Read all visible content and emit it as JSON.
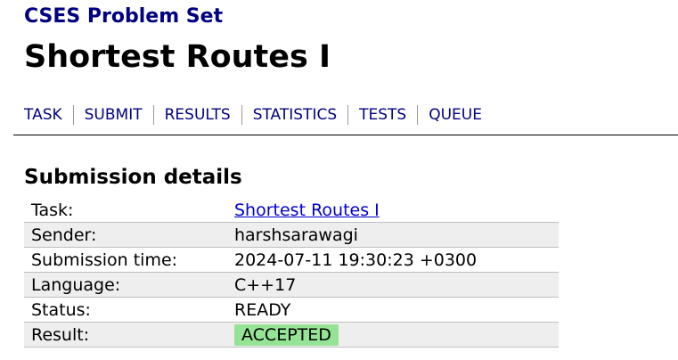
{
  "site": {
    "title": "CSES Problem Set"
  },
  "page": {
    "title": "Shortest Routes I"
  },
  "nav": {
    "items": [
      "TASK",
      "SUBMIT",
      "RESULTS",
      "STATISTICS",
      "TESTS",
      "QUEUE"
    ]
  },
  "section": {
    "title": "Submission details"
  },
  "details": {
    "task_label": "Task:",
    "task_value": "Shortest Routes I",
    "sender_label": "Sender:",
    "sender_value": "harshsarawagi",
    "time_label": "Submission time:",
    "time_value": "2024-07-11 19:30:23 +0300",
    "language_label": "Language:",
    "language_value": "C++17",
    "status_label": "Status:",
    "status_value": "READY",
    "result_label": "Result:",
    "result_value": "ACCEPTED"
  },
  "colors": {
    "brand": "#000080",
    "accepted_badge": "#95e495",
    "link": "#0000cc",
    "row_alt": "#eeeeee"
  }
}
